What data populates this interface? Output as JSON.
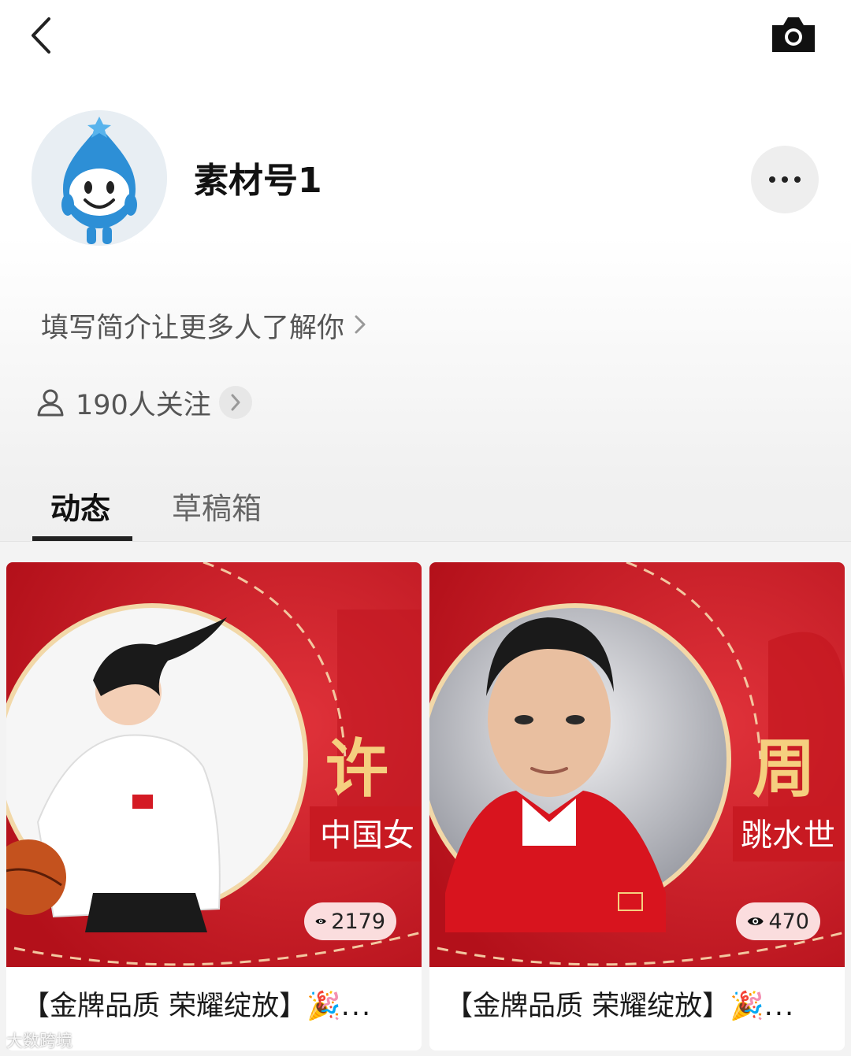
{
  "header": {
    "back_icon": "back-chevron-icon",
    "camera_icon": "camera-icon"
  },
  "profile": {
    "username": "素材号1",
    "bio_prompt": "填写简介让更多人了解你",
    "followers_text": "190人关注",
    "more_icon": "more-dots-icon"
  },
  "tabs": [
    {
      "label": "动态",
      "active": true
    },
    {
      "label": "草稿箱",
      "active": false
    }
  ],
  "posts": [
    {
      "views": "2179",
      "caption": "【金牌品质 荣耀绽放】🎉...",
      "caption_text": "【金牌品质 荣耀绽放】",
      "overlay_name_char": "许",
      "overlay_subtitle": "中国女"
    },
    {
      "views": "470",
      "caption": "【金牌品质 荣耀绽放】🎉...",
      "caption_text": "【金牌品质 荣耀绽放】",
      "overlay_name_char": "周",
      "overlay_subtitle": "跳水世"
    }
  ],
  "watermark": "大数跨境",
  "colors": {
    "accent_red": "#d41a24",
    "text_primary": "#111111",
    "text_secondary": "#555555"
  }
}
